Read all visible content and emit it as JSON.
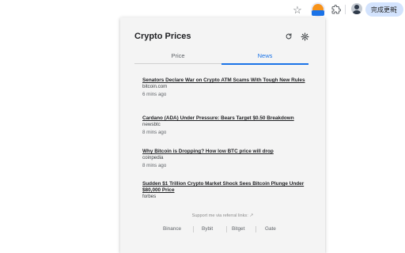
{
  "browser": {
    "update_button_label": "完成更新",
    "icons": {
      "bookmark": "star-icon",
      "extension": "crypto-prices-extension-icon",
      "extensions_menu": "puzzle-icon",
      "profile": "avatar-icon",
      "menu": "vertical-dots-icon"
    }
  },
  "popup": {
    "title": "Crypto Prices",
    "icons": {
      "refresh": "refresh-icon",
      "settings": "gear-icon"
    },
    "tabs": [
      {
        "label": "Price",
        "active": false
      },
      {
        "label": "News",
        "active": true
      }
    ],
    "news": [
      {
        "title": "Senators Declare War on Crypto ATM Scams With Tough New Rules",
        "source": "bitcoin.com",
        "time": "6 mins ago"
      },
      {
        "title": "Cardano (ADA) Under Pressure: Bears Target $0.50 Breakdown",
        "source": "newsbtc",
        "time": "8 mins ago"
      },
      {
        "title": "Why Bitcoin is Dropping? How low BTC price will drop",
        "source": "coinpedia",
        "time": "8 mins ago"
      },
      {
        "title": "Sudden $1 Trillion Crypto Market Shock Sees Bitcoin Plunge Under $80,000 Price",
        "source": "forbes",
        "time": ""
      }
    ],
    "support_text": "Support me via referral links:",
    "referral_links": [
      "Binance",
      "Bybit",
      "Bitget",
      "Gate"
    ]
  },
  "colors": {
    "accent": "#1a73e8",
    "popup_bg": "#f4f4f4",
    "update_button_bg": "#d3e3fd"
  }
}
